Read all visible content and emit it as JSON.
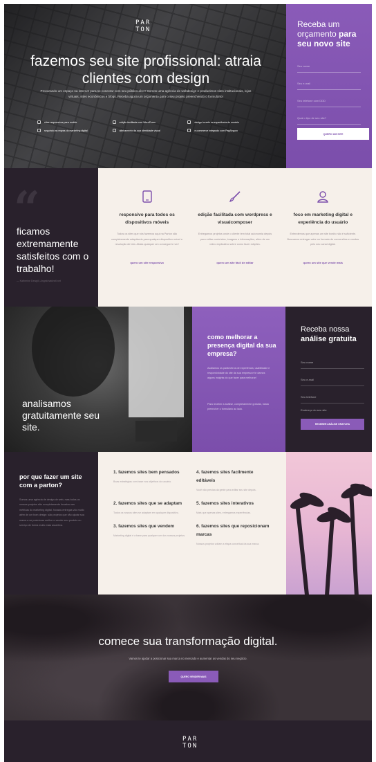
{
  "hero": {
    "logo": [
      "PAR",
      "TON"
    ],
    "title": "fazemos seu site profissional: atraia clientes com design",
    "lead": "Procurando um espaço na internet para se conectar com seu público-alvo? Somos uma agência de webdesign e produzimos sites institucionais, lojas virtuais, sites econômicos e blogs. Receba agora um orçamento para o seu projeto preenchendo o formulário!",
    "features": [
      "sites responsivos para mobile",
      "edição facilitada com WordPress",
      "design focado na experiência do usuário",
      "seguindo as regras do marketing digital",
      "alinhamento da sua identidade visual",
      "e-commerce integrado com PagSeguro"
    ],
    "form": {
      "title_a": "Receba um orçamento ",
      "title_b": "para seu novo site",
      "fields": [
        "Seu nome",
        "Seu e-mail",
        "Seu telefone com DDD",
        "Qual o tipo de seu site?"
      ],
      "button": "QUERO UM SITE"
    }
  },
  "testimonial": {
    "quote_mark": "“",
    "text": "ficamos extremamente satisfeitos com o trabalho!",
    "cite": "— Katherine Dewgill, Angelohatchell.net"
  },
  "features": [
    {
      "title": "responsivo para todos os dispositivos móveis",
      "text": "Todos os sites que nós fazemos aqui na Parton são completamente adaptáveis para qualquer dispositivo móvel e resolução de tela. Atraia qualquer um consegue te ver!",
      "link": "quero um site responsivo",
      "icon": "tablet-icon"
    },
    {
      "title": "edição facilitada com wordpress e visualcomposer",
      "text": "Entregamos projetos onde o cliente tem total autonomia depois para editar conteúdos, imagens e informações, além de um vídeo explicativo sobre como fazer edições.",
      "link": "quero um site fácil de editar",
      "icon": "brush-icon"
    },
    {
      "title": "foco em marketing digital e experiência do usuário",
      "text": "Entendemos que apenas um site bonito não é suficiente. Buscamos entregar valor no formato de conversões e vendas pelo seu canal digital.",
      "link": "quero um site que vende mais",
      "icon": "user-icon"
    }
  ],
  "analysis": {
    "photo_caption": "analisamos gratuitamente seu site.",
    "mid_title": "como melhorar a presença digital da sua empresa?",
    "mid_p1": "Avaliamos os parâmetros de experiência, usabilidade e responsividade do site da sua empresa e te damos alguns insights do que fazer para melhorar!",
    "mid_p2": "Para receber a análise, completamente gratuita, basta preencher o formulário ao lado.",
    "form_title_a": "Receba nossa ",
    "form_title_b": "análise gratuita",
    "fields": [
      "Seu nome",
      "Seu e-mail",
      "Seu telefone",
      "Endereço do seu site"
    ],
    "button": "RECEBER ANÁLISE GRATUITA"
  },
  "why": {
    "title": "por que fazer um site com a parton?",
    "text": "Somos uma agência de design de web, mas todos os nossos projetos são completamente focados nas métricas do marketing digital. Nossas entregas vão muito além de um bom design: são projetos que vão ajudar sua marca a se posicionar melhor e vender seu produto ou serviço de forma muito mais assertiva.",
    "items": [
      {
        "title": "1. fazemos sites bem pensados",
        "text": "Boas estratégias com base nos objetivos do usuário."
      },
      {
        "title": "4. fazemos sites facilmente editáveis",
        "text": "Você não precisa da gente para editar seu site depois."
      },
      {
        "title": "2. fazemos sites que se adaptam",
        "text": "Todos os nossos sites se adaptam em qualquer dispositivo."
      },
      {
        "title": "5. fazemos sites interativos",
        "text": "Mais que apenas sites, entregamos experiências."
      },
      {
        "title": "3. fazemos sites que vendem",
        "text": "Marketing digital é a base para qualquer um dos nossos projetos."
      },
      {
        "title": "6. fazemos sites que reposicionam marcas",
        "text": "Nossos projetos voltam a etapa conceitual da sua marca."
      }
    ]
  },
  "cta": {
    "title": "comece sua transformação digital.",
    "text": "Vamos te ajudar a posicionar sua marca no mercado e aumentar as vendas do seu negócio.",
    "button": "QUERO VENDER MAIS"
  },
  "footer": {
    "logo": [
      "PAR",
      "TON"
    ]
  },
  "colors": {
    "purple": "#7b4eab",
    "dark": "#29212c",
    "cream": "#f6f0ea"
  }
}
